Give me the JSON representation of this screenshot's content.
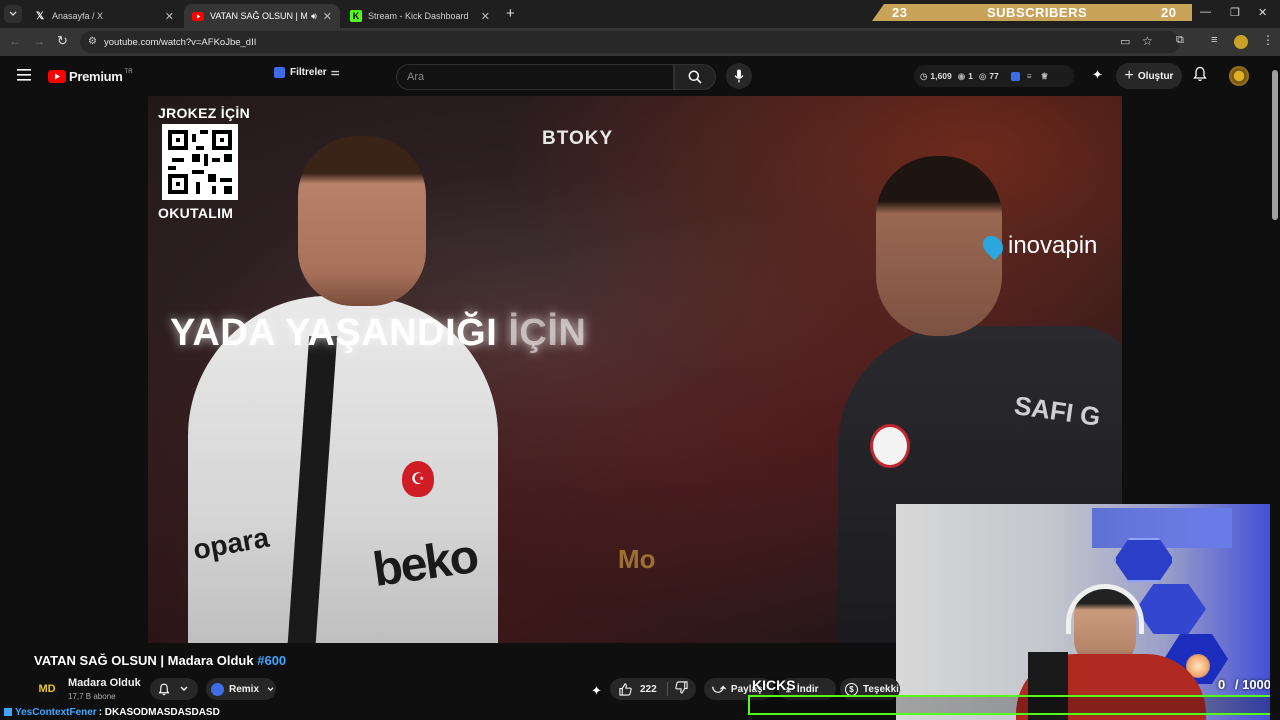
{
  "browser": {
    "tabs": [
      {
        "title": "Anasayfa / X",
        "icon": "x-logo-icon"
      },
      {
        "title": "VATAN SAĞ OLSUN | Mada",
        "icon": "youtube-icon"
      },
      {
        "title": "Stream - Kick Dashboard",
        "icon": "kick-icon"
      }
    ],
    "new_tab": "+",
    "url": "youtube.com/watch?v=AFKoJbe_dII"
  },
  "sub_goal": {
    "current": "23",
    "label": "SUBSCRIBERS",
    "goal": "20"
  },
  "youtube": {
    "logo_text": "Premium",
    "logo_region": "TR",
    "filter_label": "Filtreler",
    "search_placeholder": "Ara",
    "stats": {
      "a": "1,609",
      "b": "1",
      "c": "77"
    },
    "create_label": "Oluştur"
  },
  "video_overlay": {
    "qr_top": "JROKEZ İÇİN",
    "qr_bottom": "OKUTALIM",
    "watermark": "BTOKY",
    "caption_main": "YADA YAŞANDIĞI",
    "caption_fade": "İÇİN",
    "sponsor": "inovapin",
    "jersey_sponsor": "beko",
    "jersey_left": "opara",
    "jersey_right": "SAFI G",
    "corner_mark": "Mo",
    "badge": "MD"
  },
  "video_info": {
    "title": "VATAN SAĞ OLSUN | Madara Olduk",
    "hashtag": "#600",
    "channel": "Madara Olduk",
    "subscribers": "17,7 B abone",
    "remix_label": "Remix",
    "likes": "222",
    "share_label": "Paylaş",
    "download_label": "İndir",
    "thanks_label": "Teşekki"
  },
  "stream_overlay": {
    "chat_user": "YesContextFener",
    "chat_message": ": DKASODMASDASDASD",
    "kicks_label": "KICKS",
    "kicks_value": "0",
    "kicks_goal": "/ 1000"
  }
}
